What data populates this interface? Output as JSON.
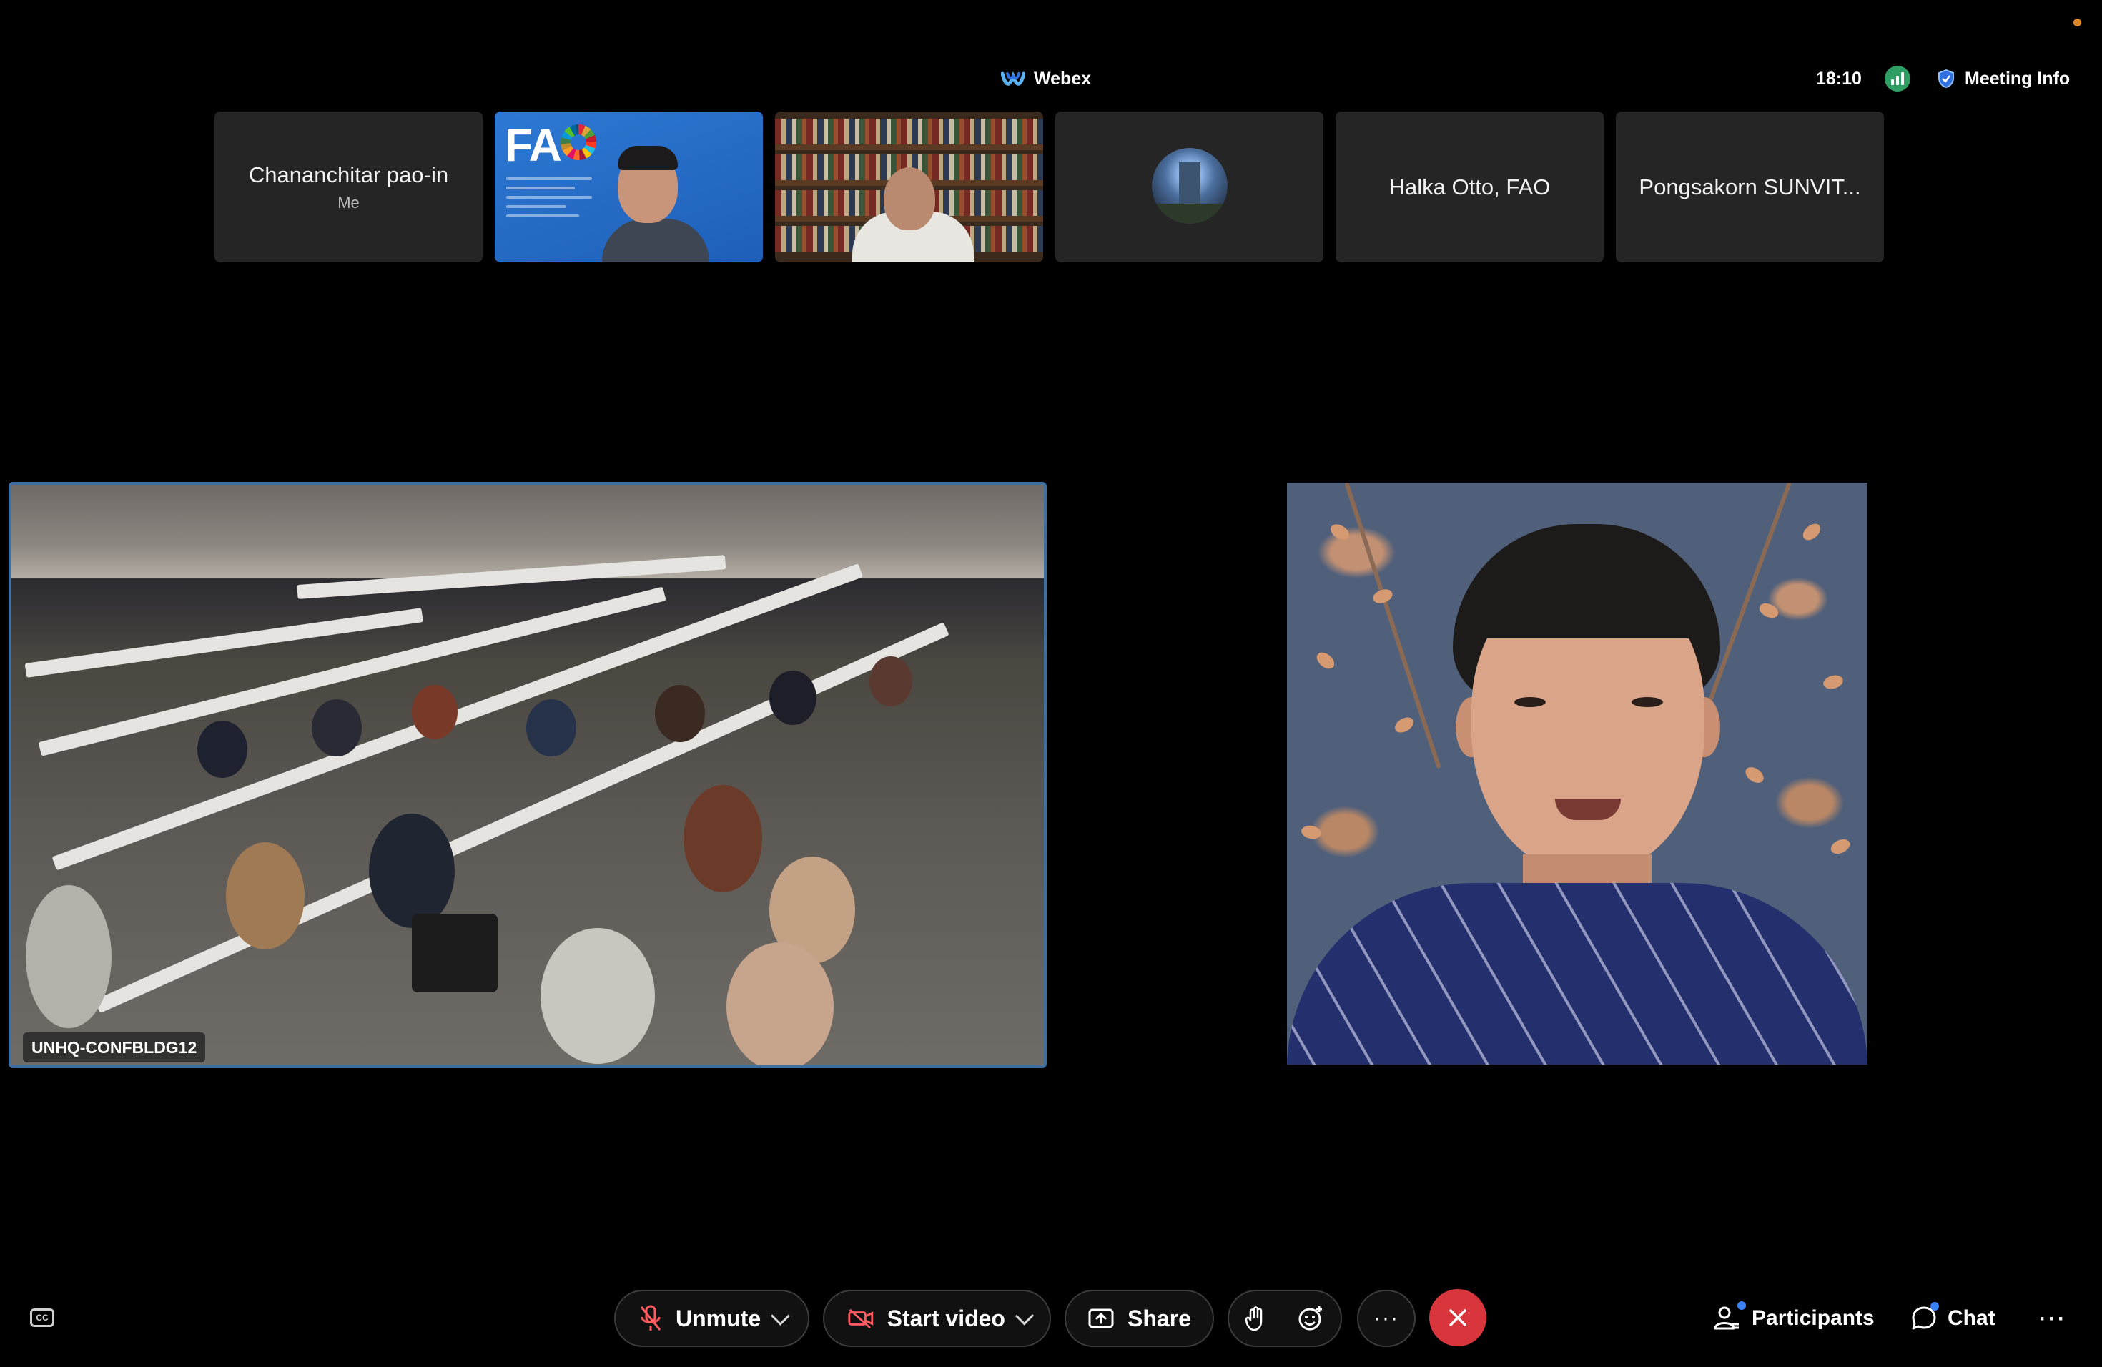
{
  "header": {
    "app_name": "Webex",
    "clock": "18:10",
    "meeting_info_label": "Meeting Info",
    "icons": [
      "webex-logo-icon",
      "network-signal-icon",
      "shield-icon"
    ]
  },
  "thumbnails": [
    {
      "name": "Chananchitar pao-in",
      "sub": "Me",
      "type": "name-only"
    },
    {
      "name": "",
      "type": "video",
      "content": "FAO slide background with speaker"
    },
    {
      "name": "",
      "type": "video",
      "content": "bookshelf background with speaker"
    },
    {
      "name": "",
      "type": "avatar"
    },
    {
      "name": "Halka Otto, FAO",
      "type": "name-only"
    },
    {
      "name": "Pongsakorn SUNVIT...",
      "type": "name-only"
    }
  ],
  "stage": {
    "room_label": "UNHQ-CONFBLDG12",
    "active_border_color": "#3e6fa1"
  },
  "controls": {
    "unmute_label": "Unmute",
    "start_video_label": "Start video",
    "share_label": "Share",
    "more_label": "···",
    "participants_label": "Participants",
    "chat_label": "Chat",
    "overflow_label": "···",
    "cc_label": "CC",
    "leave_color": "#d9353c",
    "icons": [
      "closed-captions-icon",
      "microphone-muted-icon",
      "video-off-icon",
      "share-screen-icon",
      "raise-hand-icon",
      "reaction-icon",
      "close-icon",
      "participants-icon",
      "chat-icon"
    ]
  },
  "colors": {
    "background": "#000000",
    "tile": "#252525",
    "notification_dot": "#3b82f6",
    "status_dot": "#e08a2c",
    "signal": "#2f9e64"
  }
}
